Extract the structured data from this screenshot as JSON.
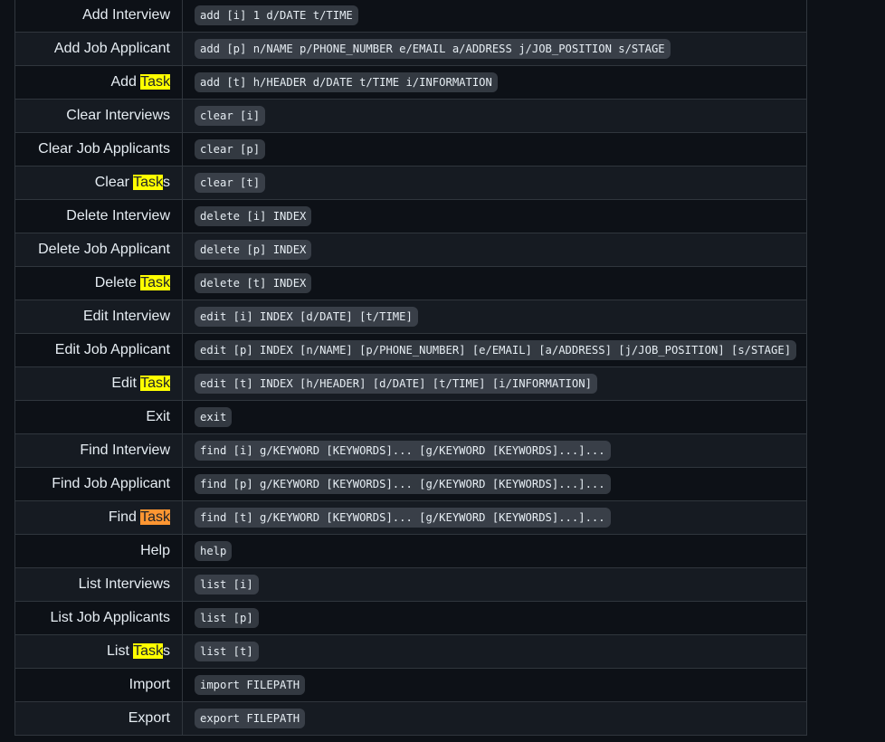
{
  "colors": {
    "background": "#0d1117",
    "row_alt": "#161b22",
    "border": "#30363d",
    "text": "#e6edf3",
    "code_bg": "rgba(110,118,129,0.4)",
    "search_highlight": "#ffff00",
    "search_highlight_active": "#ff9632"
  },
  "search_term": "Task",
  "rows": [
    {
      "cmd_pre": "Add Interview",
      "hl": "",
      "cmd_post": "",
      "format": "add [i] 1 d/DATE t/TIME"
    },
    {
      "cmd_pre": "Add Job Applicant",
      "hl": "",
      "cmd_post": "",
      "format": "add [p] n/NAME p/PHONE_NUMBER e/EMAIL a/ADDRESS j/JOB_POSITION s/STAGE"
    },
    {
      "cmd_pre": "Add ",
      "hl": "Task",
      "cmd_post": "",
      "format": "add [t] h/HEADER d/DATE t/TIME i/INFORMATION"
    },
    {
      "cmd_pre": "Clear Interviews",
      "hl": "",
      "cmd_post": "",
      "format": "clear [i]"
    },
    {
      "cmd_pre": "Clear Job Applicants",
      "hl": "",
      "cmd_post": "",
      "format": "clear [p]"
    },
    {
      "cmd_pre": "Clear ",
      "hl": "Task",
      "cmd_post": "s",
      "format": "clear [t]"
    },
    {
      "cmd_pre": "Delete Interview",
      "hl": "",
      "cmd_post": "",
      "format": "delete [i] INDEX"
    },
    {
      "cmd_pre": "Delete Job Applicant",
      "hl": "",
      "cmd_post": "",
      "format": "delete [p] INDEX"
    },
    {
      "cmd_pre": "Delete ",
      "hl": "Task",
      "cmd_post": "",
      "format": "delete [t] INDEX"
    },
    {
      "cmd_pre": "Edit Interview",
      "hl": "",
      "cmd_post": "",
      "format": "edit [i] INDEX [d/DATE] [t/TIME]"
    },
    {
      "cmd_pre": "Edit Job Applicant",
      "hl": "",
      "cmd_post": "",
      "format": "edit [p] INDEX [n/NAME] [p/PHONE_NUMBER] [e/EMAIL] [a/ADDRESS] [j/JOB_POSITION] [s/STAGE]"
    },
    {
      "cmd_pre": "Edit ",
      "hl": "Task",
      "cmd_post": "",
      "format": "edit [t] INDEX [h/HEADER] [d/DATE] [t/TIME] [i/INFORMATION]"
    },
    {
      "cmd_pre": "Exit",
      "hl": "",
      "cmd_post": "",
      "format": "exit"
    },
    {
      "cmd_pre": "Find Interview",
      "hl": "",
      "cmd_post": "",
      "format": "find [i] g/KEYWORD [KEYWORDS]... [g/KEYWORD [KEYWORDS]...]..."
    },
    {
      "cmd_pre": "Find Job Applicant",
      "hl": "",
      "cmd_post": "",
      "format": "find [p] g/KEYWORD [KEYWORDS]... [g/KEYWORD [KEYWORDS]...]..."
    },
    {
      "cmd_pre": "Find ",
      "hl": "Task",
      "cmd_post": "",
      "active": true,
      "format": "find [t] g/KEYWORD [KEYWORDS]... [g/KEYWORD [KEYWORDS]...]..."
    },
    {
      "cmd_pre": "Help",
      "hl": "",
      "cmd_post": "",
      "format": "help"
    },
    {
      "cmd_pre": "List Interviews",
      "hl": "",
      "cmd_post": "",
      "format": "list [i]"
    },
    {
      "cmd_pre": "List Job Applicants",
      "hl": "",
      "cmd_post": "",
      "format": "list [p]"
    },
    {
      "cmd_pre": "List ",
      "hl": "Task",
      "cmd_post": "s",
      "format": "list [t]"
    },
    {
      "cmd_pre": "Import",
      "hl": "",
      "cmd_post": "",
      "format": "import FILEPATH"
    },
    {
      "cmd_pre": "Export",
      "hl": "",
      "cmd_post": "",
      "format": "export FILEPATH"
    }
  ]
}
